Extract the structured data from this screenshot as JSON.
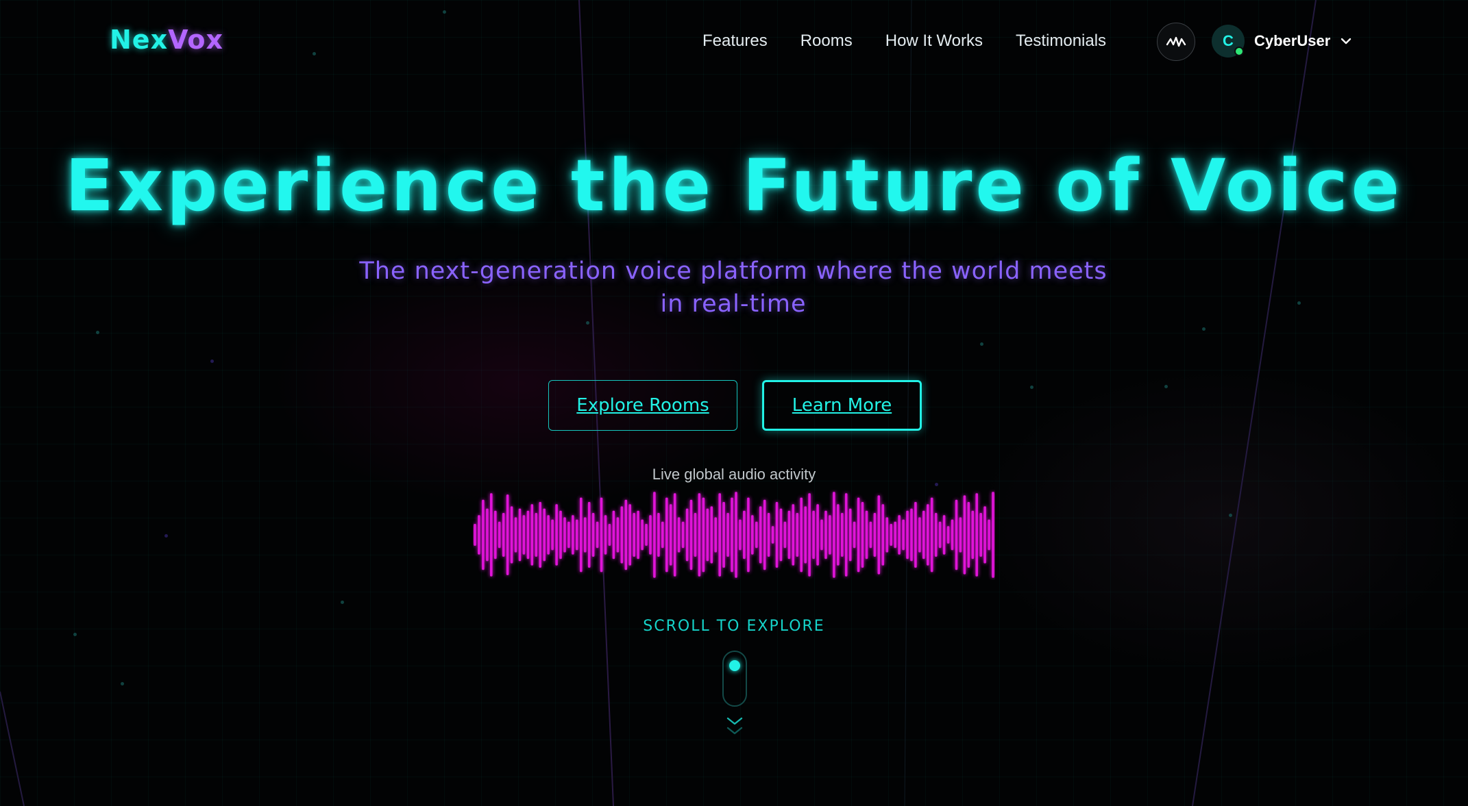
{
  "brand": {
    "part1": "Nex",
    "part2": "Vox",
    "color1": "#22f2e6",
    "color2": "#b366ff"
  },
  "nav": {
    "links": [
      "Features",
      "Rooms",
      "How It Works",
      "Testimonials"
    ],
    "audio_icon": "waveform-icon",
    "user": {
      "initial": "C",
      "name": "CyberUser",
      "menu_icon": "chevron-down-icon",
      "status": "online"
    }
  },
  "hero": {
    "title": "Experience the Future of Voice",
    "subtitle": "The next-generation voice platform where the world meets in real-time",
    "primary_button": "Explore Rooms",
    "secondary_button": "Learn More"
  },
  "activity": {
    "label": "Live global audio activity",
    "bar_color": "#e014d8",
    "levels": [
      0.25,
      0.45,
      0.8,
      0.6,
      0.95,
      0.55,
      0.3,
      0.5,
      0.92,
      0.65,
      0.4,
      0.6,
      0.45,
      0.55,
      0.7,
      0.5,
      0.75,
      0.6,
      0.45,
      0.35,
      0.7,
      0.55,
      0.4,
      0.3,
      0.45,
      0.35,
      0.85,
      0.4,
      0.75,
      0.5,
      0.3,
      0.85,
      0.45,
      0.25,
      0.55,
      0.4,
      0.65,
      0.8,
      0.7,
      0.5,
      0.55,
      0.35,
      0.25,
      0.45,
      0.98,
      0.5,
      0.3,
      0.85,
      0.7,
      0.95,
      0.4,
      0.3,
      0.6,
      0.8,
      0.5,
      0.95,
      0.85,
      0.6,
      0.65,
      0.4,
      0.95,
      0.75,
      0.5,
      0.85,
      0.98,
      0.35,
      0.55,
      0.85,
      0.45,
      0.3,
      0.65,
      0.8,
      0.5,
      0.2,
      0.75,
      0.6,
      0.3,
      0.55,
      0.7,
      0.5,
      0.85,
      0.65,
      0.95,
      0.55,
      0.7,
      0.35,
      0.55,
      0.45,
      0.98,
      0.7,
      0.5,
      0.95,
      0.6,
      0.3,
      0.85,
      0.75,
      0.55,
      0.3,
      0.5,
      0.9,
      0.7,
      0.4,
      0.25,
      0.3,
      0.45,
      0.35,
      0.55,
      0.6,
      0.75,
      0.4,
      0.55,
      0.7,
      0.85,
      0.5,
      0.3,
      0.45,
      0.2,
      0.35,
      0.8,
      0.4,
      0.9,
      0.75,
      0.55,
      0.95,
      0.5,
      0.65,
      0.35,
      0.98
    ]
  },
  "scroll": {
    "label": "SCROLL TO EXPLORE"
  }
}
